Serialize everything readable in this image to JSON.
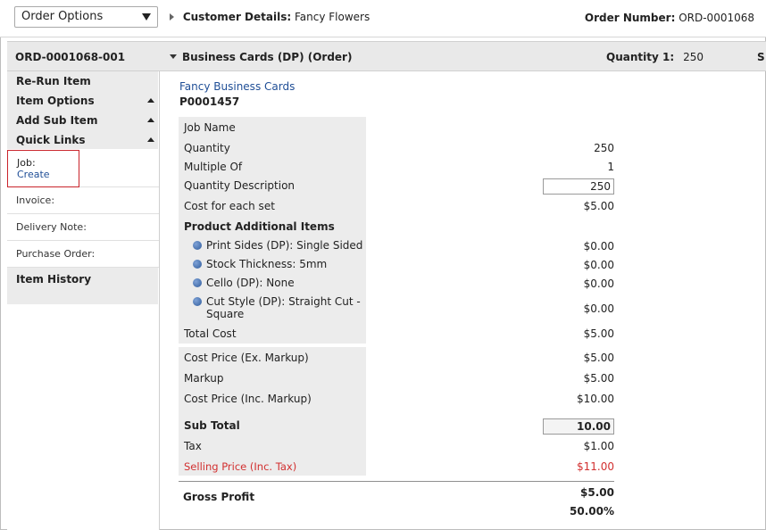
{
  "topbar": {
    "select_value": "Order Options",
    "customer_label": "Customer Details:",
    "customer_value": "Fancy Flowers",
    "order_number_label": "Order Number:",
    "order_number_value": "ORD-0001068"
  },
  "subheader": {
    "item_code": "ORD-0001068-001",
    "product_title": "Business Cards (DP) (Order)",
    "quantity_label": "Quantity 1:",
    "quantity_value": "250",
    "trailing": "S"
  },
  "sidebar": {
    "items": [
      {
        "label": "Re-Run Item"
      },
      {
        "label": "Item Options"
      },
      {
        "label": "Add Sub Item"
      },
      {
        "label": "Quick Links"
      }
    ],
    "job_label": "Job:",
    "job_link": "Create",
    "links": [
      "Invoice:",
      "Delivery Note:",
      "Purchase Order:"
    ],
    "history_label": "Item History"
  },
  "product": {
    "title": "Fancy Business Cards",
    "code": "P0001457"
  },
  "pricing": {
    "job_name_label": "Job Name",
    "quantity_label": "Quantity",
    "quantity_value": "250",
    "multiple_label": "Multiple Of",
    "multiple_value": "1",
    "qty_desc_label": "Quantity Description",
    "qty_desc_value": "250",
    "cost_each_label": "Cost for each set",
    "cost_each_value": "$5.00",
    "additional_heading": "Product Additional Items",
    "additional_items": [
      {
        "label": "Print Sides (DP): Single Sided",
        "value": "$0.00"
      },
      {
        "label": "Stock Thickness: 5mm",
        "value": "$0.00"
      },
      {
        "label": "Cello (DP): None",
        "value": "$0.00"
      },
      {
        "label": "Cut Style (DP): Straight Cut -",
        "label2": "Square",
        "value": "$0.00"
      }
    ],
    "total_cost_label": "Total Cost",
    "total_cost_value": "$5.00",
    "cost_ex_label": "Cost Price (Ex. Markup)",
    "cost_ex_value": "$5.00",
    "markup_label": "Markup",
    "markup_value": "$5.00",
    "cost_inc_label": "Cost Price (Inc. Markup)",
    "cost_inc_value": "$10.00",
    "subtotal_label": "Sub Total",
    "subtotal_value": "10.00",
    "tax_label": "Tax",
    "tax_value": "$1.00",
    "selling_label": "Selling Price (Inc. Tax)",
    "selling_value": "$11.00",
    "gross_label": "Gross Profit",
    "gross_value": "$5.00",
    "gross_percent": "50.00%",
    "colors": {
      "link": "#1f4e96",
      "highlight": "#d23030"
    }
  }
}
